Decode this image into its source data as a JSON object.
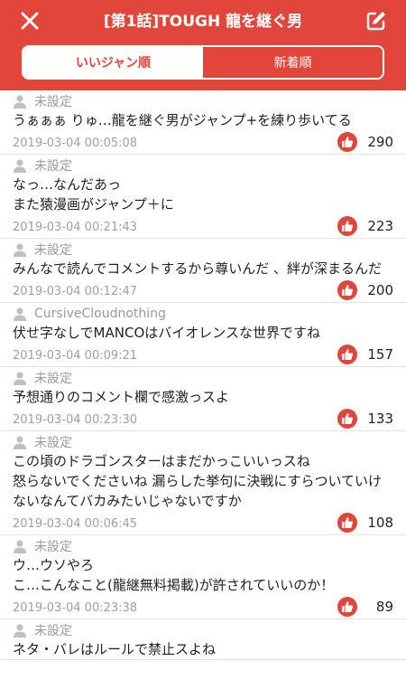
{
  "header": {
    "title": "[第1話]TOUGH 龍を継ぐ男",
    "bg_color": "#e2463a",
    "close_icon": "close-icon",
    "edit_icon": "edit-icon"
  },
  "tabs": [
    {
      "label": "いいジャン順",
      "active": true
    },
    {
      "label": "新着順",
      "active": false
    }
  ],
  "comments": [
    {
      "user": "未設定",
      "text": "うぁぁぁ りゅ…龍を継ぐ男がジャンプ+を練り歩いてる",
      "date": "2019-03-04 00:05:08",
      "likes": "290"
    },
    {
      "user": "未設定",
      "text": "なっ…なんだあっ\nまた猿漫画がジャンプ＋に",
      "date": "2019-03-04 00:21:43",
      "likes": "223"
    },
    {
      "user": "未設定",
      "text": "みんなで読んでコメントするから尊いんだ 、絆が深まるんだ",
      "date": "2019-03-04 00:12:47",
      "likes": "200"
    },
    {
      "user": "CursiveCloudnothing",
      "text": "伏せ字なしでMANCOはバイオレンスな世界ですね",
      "date": "2019-03-04 00:09:21",
      "likes": "157"
    },
    {
      "user": "未設定",
      "text": "予想通りのコメント欄で感激っスよ",
      "date": "2019-03-04 00:23:30",
      "likes": "133"
    },
    {
      "user": "未設定",
      "text": "この頃のドラゴンスターはまだかっこいいっスね\n怒らないでくださいね 漏らした挙句に決戦にすらついていけないなんてバカみたいじゃないですか",
      "date": "2019-03-04 00:06:45",
      "likes": "108"
    },
    {
      "user": "未設定",
      "text": "ウ…ウソやろ\nこ…こんなこと(龍継無料掲載)が許されていいのか！",
      "date": "2019-03-04 00:23:38",
      "likes": "89"
    },
    {
      "user": "未設定",
      "text": "ネタ・バレはルールで禁止スよね",
      "date": "",
      "likes": ""
    }
  ]
}
